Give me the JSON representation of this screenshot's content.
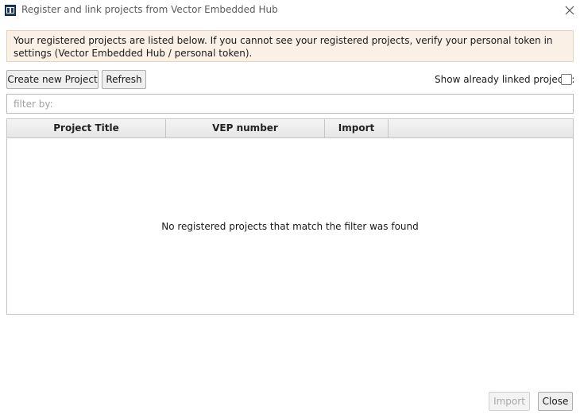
{
  "window": {
    "title": "Register and link projects from Vector Embedded Hub",
    "icon": "vector-hub-icon"
  },
  "info": {
    "message": "Your registered projects are listed below. If you cannot see your registered projects, verify your personal token in settings (Vector Embedded Hub / personal token)."
  },
  "toolbar": {
    "create_label": "Create new Project",
    "refresh_label": "Refresh",
    "show_linked_label": "Show already linked projects:",
    "show_linked_checked": false
  },
  "filter": {
    "placeholder": "filter by:",
    "value": ""
  },
  "table": {
    "columns": [
      "Project Title",
      "VEP number",
      "Import"
    ],
    "rows": [],
    "empty_message": "No registered projects that match the filter was found"
  },
  "footer": {
    "import_label": "Import",
    "import_enabled": false,
    "close_label": "Close"
  },
  "colors": {
    "info_background": "#fbf0e6",
    "header_background": "#ececec",
    "button_background": "#efefef"
  }
}
